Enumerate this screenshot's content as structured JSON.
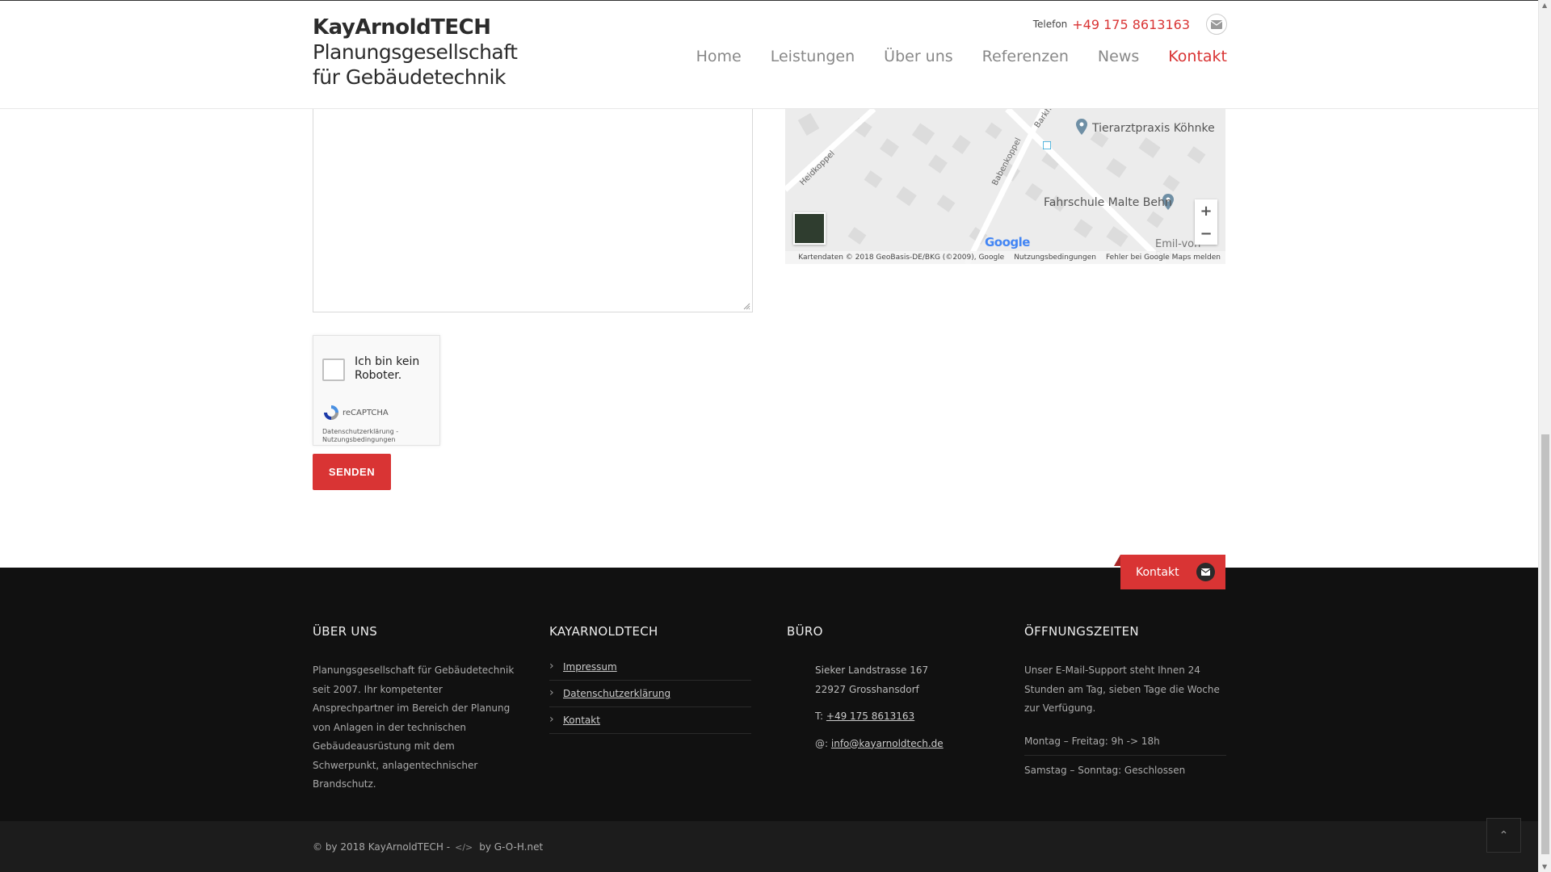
{
  "header": {
    "brand_name": "KayArnoldTECH",
    "brand_tagline_1": "Planungsgesellschaft",
    "brand_tagline_2": "für Gebäudetechnik",
    "phone_label": "Telefon",
    "phone_number": "+49 175 8613163",
    "nav": [
      {
        "label": "Home"
      },
      {
        "label": "Leistungen"
      },
      {
        "label": "Über uns"
      },
      {
        "label": "Referenzen"
      },
      {
        "label": "News"
      },
      {
        "label": "Kontakt",
        "active": true
      }
    ]
  },
  "map": {
    "places": [
      "Tierarztpraxis Köhnke",
      "Fahrschule Malte Behn",
      "Emil-von-Behr"
    ],
    "streets": [
      "Heidkoppel",
      "Babenkoppel",
      "Barkh"
    ],
    "zoom_in": "+",
    "zoom_out": "−",
    "logo": "Google",
    "footer_attribution": "Kartendaten © 2018 GeoBasis-DE/BKG (©2009), Google",
    "footer_terms": "Nutzungsbedingungen",
    "footer_report": "Fehler bei Google Maps melden"
  },
  "recaptcha": {
    "label": "Ich bin kein Roboter.",
    "brand": "reCAPTCHA",
    "links_1": "Datenschutzerklärung -",
    "links_2": "Nutzungsbedingungen"
  },
  "form": {
    "send_label": "SENDEN"
  },
  "footer_tab": {
    "label": "Kontakt"
  },
  "footer": {
    "about_title": "ÜBER UNS",
    "about_text": "Planungsgesellschaft für Gebäudetechnik seit 2007. Ihr kompetenter Ansprechpartner im Bereich der Planung von Anlagen in der technischen Gebäudeausrüstung mit dem Schwerpunkt, anlagentechnischer Brandschutz.",
    "links_title": "KAYARNOLDTECH",
    "links": [
      {
        "label": "Impressum"
      },
      {
        "label": "Datenschutzerklärung"
      },
      {
        "label": "Kontakt"
      }
    ],
    "office_title": "BÜRO",
    "office_street": "Sieker Landstrasse 167",
    "office_city": "22927 Grosshansdorf",
    "office_phone_prefix": "T:",
    "office_phone": "+49 175 8613163",
    "office_email_prefix": "@:",
    "office_email": "info@kayarnoldtech.de",
    "hours_title": "ÖFFNUNGSZEITEN",
    "hours_text": "Unser E-Mail-Support steht Ihnen 24 Stunden am Tag, sieben Tage die Woche zur Verfügung.",
    "hours": [
      {
        "label": "Montag – Freitag: 9h -> 18h"
      },
      {
        "label": "Samstag – Sonntag: Geschlossen"
      }
    ]
  },
  "copyright": {
    "text": "© by 2018 KayArnoldTECH -",
    "credit": "by G-O-H.net"
  },
  "colors": {
    "accent": "#d93434",
    "footer_bg": "#111111"
  },
  "icons": {
    "mail": "envelope-icon",
    "to_top": "chevron-double-up-icon",
    "code": "code-icon"
  }
}
